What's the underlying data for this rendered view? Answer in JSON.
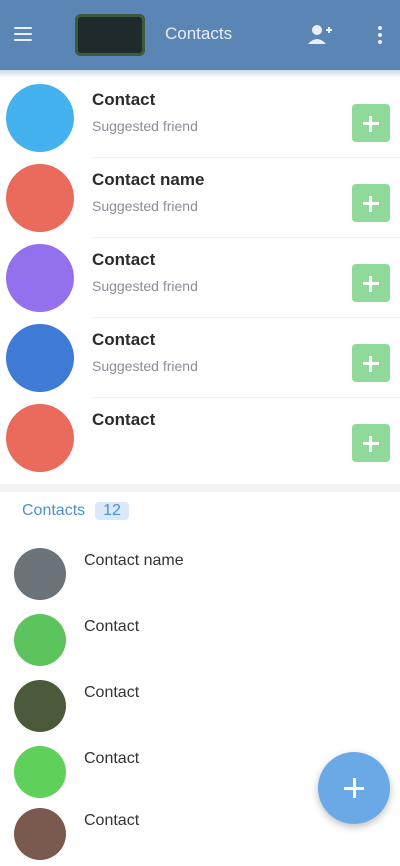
{
  "appbar": {
    "title": "Contacts",
    "menu_icon": "menu-icon",
    "action_icon": "person-add-icon",
    "more_icon": "more-vert-icon",
    "colors": {
      "bar": "#5b85b5",
      "logo": "#1e2a2c"
    }
  },
  "suggestions": [
    {
      "name": "Contact",
      "subtitle": "Suggested friend",
      "avatar_color": "#45b2f0",
      "add_icon": "add-icon"
    },
    {
      "name": "Contact name",
      "subtitle": "Suggested friend",
      "avatar_color": "#ea6a5c",
      "add_icon": "add-icon"
    },
    {
      "name": "Contact",
      "subtitle": "Suggested friend",
      "avatar_color": "#9370ee",
      "add_icon": "add-icon"
    },
    {
      "name": "Contact",
      "subtitle": "Suggested friend",
      "avatar_color": "#3f7ad6",
      "add_icon": "add-icon"
    },
    {
      "name": "Contact",
      "subtitle": "",
      "avatar_color": "#ea6a5c",
      "add_icon": "add-icon"
    }
  ],
  "section": {
    "label": "Contacts",
    "count": "12"
  },
  "contacts": [
    {
      "name": "Contact name",
      "status": "",
      "avatar_color": "#6b7378"
    },
    {
      "name": "Contact",
      "status": "",
      "avatar_color": "#5dc35c"
    },
    {
      "name": "Contact",
      "status": "",
      "avatar_color": "#4b5a3a"
    },
    {
      "name": "Contact",
      "status": "",
      "avatar_color": "#5fd15a"
    },
    {
      "name": "Contact",
      "status": "",
      "avatar_color": "#7a5a4e"
    }
  ],
  "fab": {
    "icon": "add-icon",
    "color": "#6aa9e6"
  }
}
